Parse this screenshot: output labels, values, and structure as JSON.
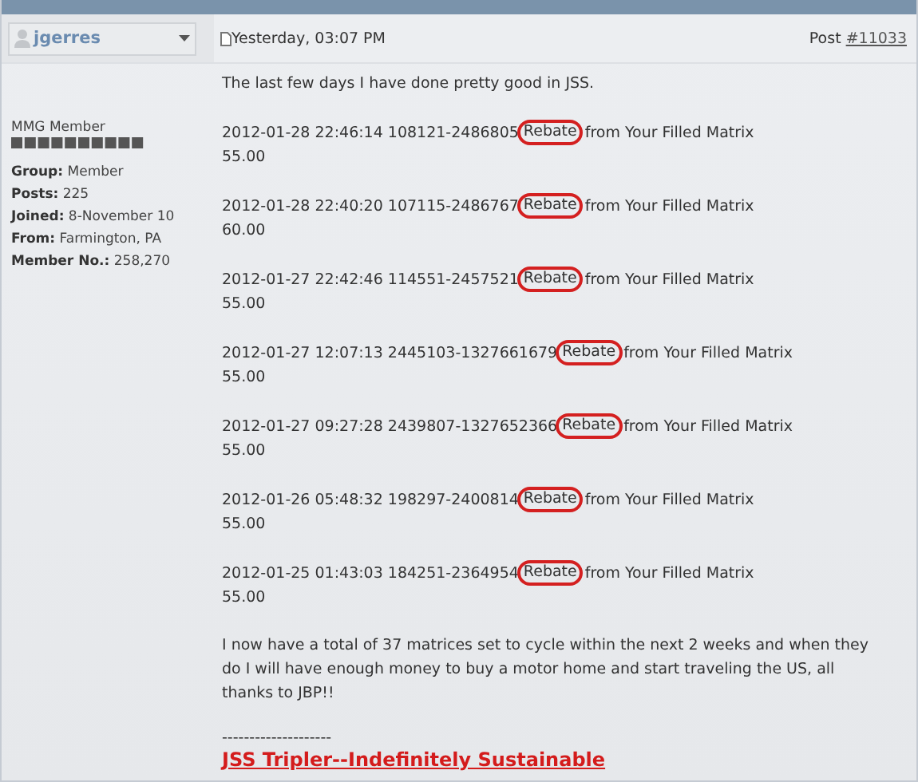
{
  "post": {
    "author": "jgerres",
    "date": "Yesterday, 03:07 PM",
    "post_label": "Post",
    "post_number": "#11033"
  },
  "profile": {
    "rank": "MMG Member",
    "fields": [
      {
        "label": "Group:",
        "value": "Member"
      },
      {
        "label": "Posts:",
        "value": "225"
      },
      {
        "label": "Joined:",
        "value": "8-November 10"
      },
      {
        "label": "From:",
        "value": "Farmington, PA"
      },
      {
        "label": "Member No.:",
        "value": "258,270"
      }
    ]
  },
  "body": {
    "intro": "The last few days I have done pretty good in JSS.",
    "entries": [
      {
        "reference": "2012-01-28 22:46:14 108121-2486805",
        "circled": "Rebate",
        "description": "from Your Filled Matrix",
        "amount": "55.00"
      },
      {
        "reference": "2012-01-28 22:40:20 107115-2486767",
        "circled": "Rebate",
        "description": "from Your Filled Matrix",
        "amount": "60.00"
      },
      {
        "reference": "2012-01-27 22:42:46 114551-2457521",
        "circled": "Rebate",
        "description": "from Your Filled Matrix",
        "amount": "55.00"
      },
      {
        "reference": "2012-01-27 12:07:13 2445103-1327661679",
        "circled": "Rebate",
        "description": "from Your Filled Matrix",
        "amount": "55.00"
      },
      {
        "reference": "2012-01-27 09:27:28 2439807-1327652366",
        "circled": "Rebate",
        "description": "from Your Filled Matrix",
        "amount": "55.00"
      },
      {
        "reference": "2012-01-26 05:48:32 198297-2400814",
        "circled": "Rebate",
        "description": "from Your Filled Matrix",
        "amount": "55.00"
      },
      {
        "reference": "2012-01-25 01:43:03 184251-2364954",
        "circled": "Rebate",
        "description": "from Your Filled Matrix",
        "amount": "55.00"
      }
    ],
    "closing": "I now have a total of 37 matrices set to cycle within the next 2 weeks and when they do I will have enough money to buy a motor home and start traveling the US, all thanks to JBP!!",
    "signature_rule": "--------------------",
    "signature_link": "JSS Tripler--Indefinitely Sustainable"
  }
}
